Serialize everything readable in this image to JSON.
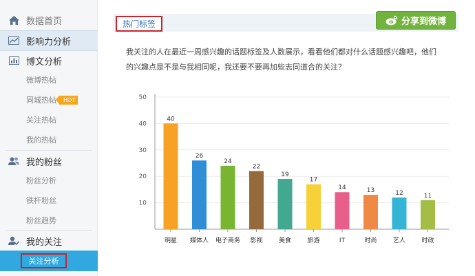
{
  "sidebar": {
    "items": [
      {
        "label": "数据首页",
        "type": "main",
        "icon": "home-icon"
      },
      {
        "label": "影响力分析",
        "type": "main",
        "icon": "trend-chart-icon",
        "active": true
      },
      {
        "label": "博文分析",
        "type": "main",
        "icon": "bar-chart-icon"
      },
      {
        "label": "微博热帖",
        "type": "sub"
      },
      {
        "label": "同城热帖",
        "type": "sub",
        "badge": "HOT"
      },
      {
        "label": "关注热帖",
        "type": "sub"
      },
      {
        "label": "我的热帖",
        "type": "sub"
      },
      {
        "label": "我的粉丝",
        "type": "main",
        "icon": "users-icon"
      },
      {
        "label": "粉丝分析",
        "type": "sub"
      },
      {
        "label": "铁杆粉丝",
        "type": "sub"
      },
      {
        "label": "粉丝趋势",
        "type": "sub"
      },
      {
        "label": "我的关注",
        "type": "main",
        "icon": "user-follow-icon"
      },
      {
        "label": "关注分析",
        "type": "sub",
        "selected": true
      }
    ]
  },
  "header": {
    "title": "热门标签",
    "share_label": "分享到微博"
  },
  "description": {
    "line1": "我关注的人在最近一周感兴趣的话题标签及人数展示，看看他们都对什么话题感兴趣吧，他们",
    "line2": "的兴趣点是不是与我相同呢，我还要不要再加些志同道合的关注？"
  },
  "colors": {
    "accent_blue": "#31a8e0",
    "highlight_red": "#c9232c",
    "share_green": "#71b33c"
  },
  "chart_data": {
    "type": "bar",
    "categories": [
      "明星",
      "媒体人",
      "电子商务",
      "影视",
      "美食",
      "旅游",
      "IT",
      "时尚",
      "艺人",
      "时政"
    ],
    "values": [
      40,
      26,
      24,
      22,
      19,
      17,
      14,
      13,
      12,
      11
    ],
    "colors": [
      "#f7a225",
      "#2f8ed6",
      "#7ab532",
      "#946a3c",
      "#42a990",
      "#f6d138",
      "#e85f8c",
      "#ee8a45",
      "#35b5d6",
      "#a3bd45"
    ],
    "ylim": [
      0,
      50
    ],
    "yticks": [
      10,
      20,
      30,
      40,
      50
    ],
    "grid": true,
    "title": "",
    "xlabel": "",
    "ylabel": ""
  }
}
